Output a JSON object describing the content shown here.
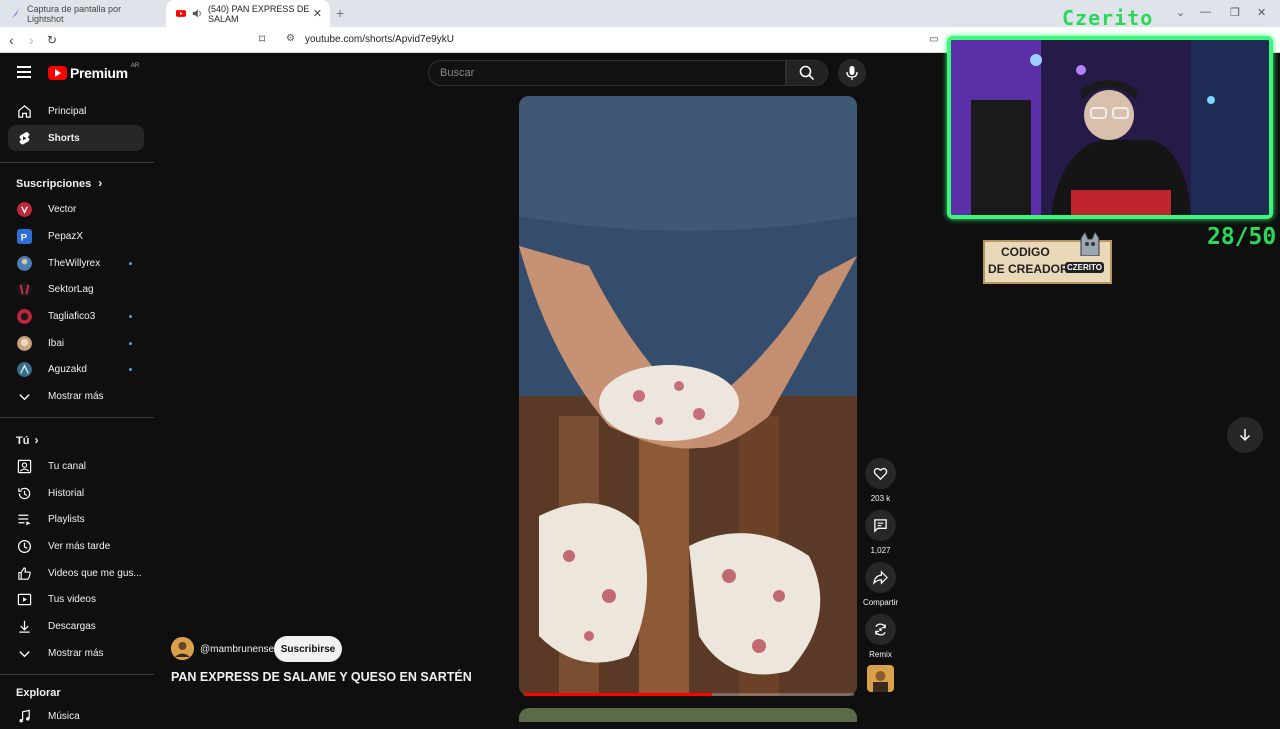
{
  "browser": {
    "tabs": [
      {
        "label": "Captura de pantalla por Lightshot"
      },
      {
        "label": "(540) PAN EXPRESS DE SALAM"
      }
    ],
    "url": "youtube.com/shorts/Apvid7e9ykU"
  },
  "header": {
    "logo_word": "Premium",
    "country_code": "AR",
    "search_placeholder": "Buscar"
  },
  "sidebar": {
    "main": [
      {
        "label": "Principal",
        "icon": "home-icon"
      },
      {
        "label": "Shorts",
        "icon": "shorts-icon"
      }
    ],
    "subs_title": "Suscripciones",
    "subs": [
      {
        "label": "Vector",
        "color": "#c0283a",
        "dot": false
      },
      {
        "label": "PepazX",
        "color": "#2d6fd6",
        "dot": false
      },
      {
        "label": "TheWillyrex",
        "color": "#4a7fb5",
        "dot": true
      },
      {
        "label": "SektorLag",
        "color": "#d12b4a",
        "dot": false
      },
      {
        "label": "Tagliafico3",
        "color": "#c2263b",
        "dot": true
      },
      {
        "label": "Ibai",
        "color": "#c8a27a",
        "dot": true
      },
      {
        "label": "Aguzakd",
        "color": "#3b6d8a",
        "dot": true
      }
    ],
    "subs_more": "Mostrar más",
    "you_title": "Tú",
    "you": [
      {
        "label": "Tu canal",
        "icon": "channel-icon"
      },
      {
        "label": "Historial",
        "icon": "history-icon"
      },
      {
        "label": "Playlists",
        "icon": "playlists-icon"
      },
      {
        "label": "Ver más tarde",
        "icon": "watch-later-icon"
      },
      {
        "label": "Videos que me gus...",
        "icon": "like-icon"
      },
      {
        "label": "Tus videos",
        "icon": "your-videos-icon"
      },
      {
        "label": "Descargas",
        "icon": "download-icon"
      }
    ],
    "you_more": "Mostrar más",
    "explore_title": "Explorar",
    "explore": [
      {
        "label": "Música",
        "icon": "music-icon"
      }
    ]
  },
  "short": {
    "channel": "@mambrunense",
    "subscribe_label": "Suscribirse",
    "title": "PAN EXPRESS DE SALAME Y QUESO EN SARTÉN",
    "progress": 0.57,
    "actions": [
      {
        "label": "203 k",
        "icon": "like-icon"
      },
      {
        "label": "1,027",
        "icon": "comment-icon"
      },
      {
        "label": "Compartir",
        "icon": "share-icon"
      },
      {
        "label": "Remix",
        "icon": "remix-icon"
      }
    ]
  },
  "overlay": {
    "streamer_name": "Czerito",
    "counter": "28/50",
    "code_line1": "CODIGO",
    "code_line2": "DE CREADOR",
    "code_tag": "CZERITO"
  },
  "colors": {
    "accent": "#ff0000",
    "overlay_green": "#2cd85a",
    "unread_dot": "#3ea6ff"
  }
}
